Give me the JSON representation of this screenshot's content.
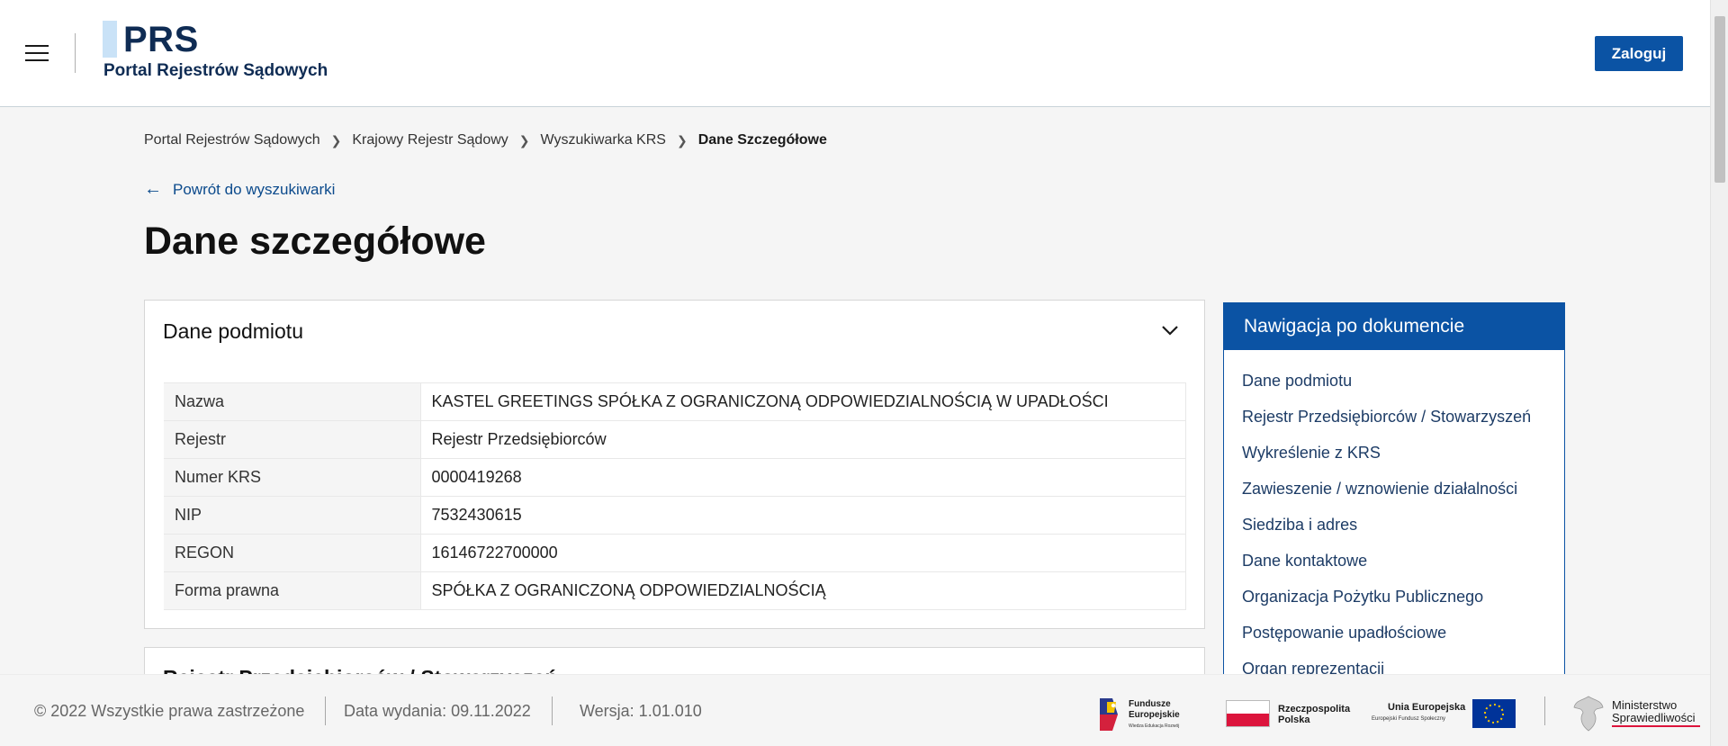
{
  "header": {
    "logo_abbr": "PRS",
    "logo_subtitle": "Portal Rejestrów Sądowych",
    "login_label": "Zaloguj"
  },
  "breadcrumb": [
    "Portal Rejestrów Sądowych",
    "Krajowy Rejestr Sądowy",
    "Wyszukiwarka KRS",
    "Dane Szczegółowe"
  ],
  "back_link": "Powrót do wyszukiwarki",
  "page_title": "Dane szczegółowe",
  "entity_card": {
    "title": "Dane podmiotu",
    "rows": [
      {
        "label": "Nazwa",
        "value": "KASTEL GREETINGS SPÓŁKA Z OGRANICZONĄ ODPOWIEDZIALNOŚCIĄ W UPADŁOŚCI"
      },
      {
        "label": "Rejestr",
        "value": "Rejestr Przedsiębiorców"
      },
      {
        "label": "Numer KRS",
        "value": "0000419268"
      },
      {
        "label": "NIP",
        "value": "7532430615"
      },
      {
        "label": "REGON",
        "value": "16146722700000"
      },
      {
        "label": "Forma prawna",
        "value": "SPÓŁKA Z OGRANICZONĄ ODPOWIEDZIALNOŚCIĄ"
      }
    ]
  },
  "next_card_title": "Rejestr Przedsiębiorców / Stowarzyszeń",
  "sidenav": {
    "title": "Nawigacja po dokumencie",
    "items": [
      "Dane podmiotu",
      "Rejestr Przedsiębiorców / Stowarzyszeń",
      "Wykreślenie z KRS",
      "Zawieszenie / wznowienie działalności",
      "Siedziba i adres",
      "Dane kontaktowe",
      "Organizacja Pożytku Publicznego",
      "Postępowanie upadłościowe",
      "Organ reprezentacji"
    ]
  },
  "footer": {
    "copyright": "© 2022 Wszystkie prawa zastrzeżone",
    "release_date": "Data wydania: 09.11.2022",
    "version": "Wersja: 1.01.010",
    "logos": {
      "fe_line1": "Fundusze",
      "fe_line2": "Europejskie",
      "fe_line3": "Wiedza Edukacja Rozwój",
      "rp_line1": "Rzeczpospolita",
      "rp_line2": "Polska",
      "ue_line1": "Unia Europejska",
      "ue_line2": "Europejski Fundusz Społeczny",
      "ms_line1": "Ministerstwo",
      "ms_line2": "Sprawiedliwości"
    }
  },
  "colors": {
    "primary": "#0b53a4",
    "brand_dark": "#0f2c54",
    "background": "#f5f5f5"
  }
}
